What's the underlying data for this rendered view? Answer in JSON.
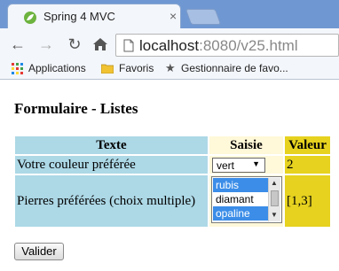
{
  "browser": {
    "tab_title": "Spring 4 MVC",
    "tab_close": "×",
    "url_host": "localhost",
    "url_rest": ":8080/v25.html",
    "bookmarks": [
      {
        "label": "Applications",
        "icon": "apps-grid-icon"
      },
      {
        "label": "Favoris",
        "icon": "folder-icon"
      },
      {
        "label": "Gestionnaire de favo...",
        "icon": "star-icon"
      }
    ]
  },
  "page": {
    "title": "Formulaire - Listes",
    "headers": {
      "texte": "Texte",
      "saisie": "Saisie",
      "valeur": "Valeur"
    },
    "row1": {
      "label": "Votre couleur préférée",
      "select_value": "vert",
      "value": "2"
    },
    "row2": {
      "label": "Pierres préférées (choix multiple)",
      "options": [
        "rubis",
        "diamant",
        "opaline"
      ],
      "selected": [
        "rubis",
        "opaline"
      ],
      "value": "[1,3]"
    },
    "submit_label": "Valider"
  },
  "colors": {
    "header_blue": "#add8e6",
    "saisie_cream": "#fff8d9",
    "valeur_yellow": "#e6d21f",
    "selected_option": "#3b8de8"
  }
}
